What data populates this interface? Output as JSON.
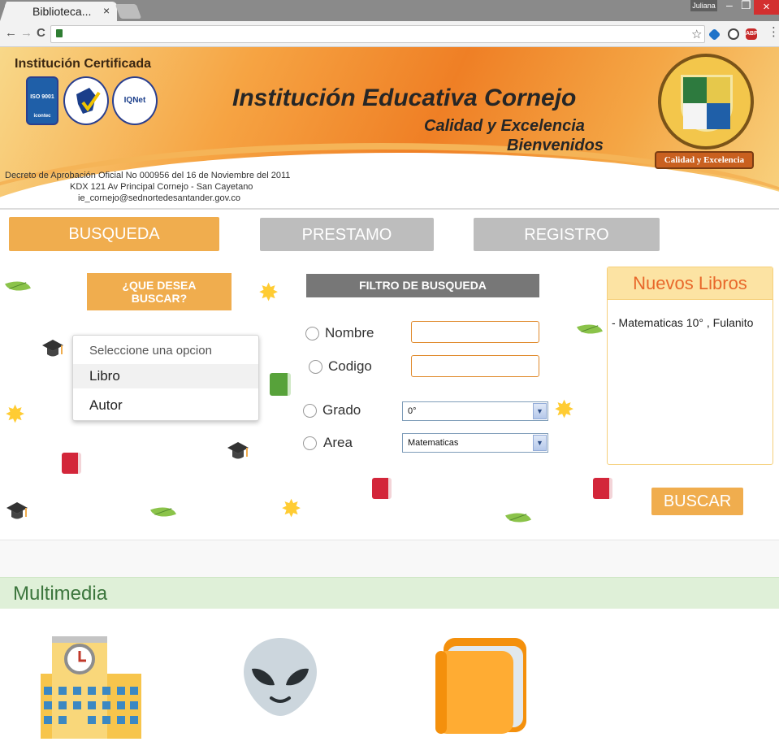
{
  "browser": {
    "tab_title": "Biblioteca...",
    "tab_close": "×",
    "user": "Juliana",
    "back": "←",
    "forward": "→",
    "reload": "C",
    "bookmark": "☆",
    "menu": "⋮",
    "ext_abp": "ABP"
  },
  "banner": {
    "certified": "Institución Certificada",
    "name": "Institución Educativa Cornejo",
    "tagline": "Calidad y Excelencia",
    "welcome": "Bienvenidos",
    "crest_motto": "Calidad y Excelencia",
    "logos": [
      "ISO 9001",
      "icontec",
      "IQNet"
    ],
    "decree_lines": [
      "Decreto de Aprobación Oficial  No 000956 del 16 de Noviembre del 2011",
      "KDX 121 Av Principal Cornejo - San Cayetano",
      "ie_cornejo@sednortedesantander.gov.co"
    ]
  },
  "nav": {
    "busqueda": "BUSQUEDA",
    "prestamo": "PRESTAMO",
    "registro": "REGISTRO"
  },
  "search": {
    "que_desea_line1": "¿QUE DESEA",
    "que_desea_line2": "BUSCAR?",
    "dropdown": {
      "placeholder": "Seleccione una opcion",
      "options": [
        "Libro",
        "Autor"
      ]
    },
    "filter_title": "FILTRO DE BUSQUEDA",
    "fields": {
      "nombre": "Nombre",
      "codigo": "Codigo",
      "grado": "Grado",
      "area": "Area"
    },
    "grado_value": "0°",
    "area_value": "Matematicas",
    "buscar": "BUSCAR"
  },
  "nuevos": {
    "title": "Nuevos Libros",
    "items": [
      "- Matematicas 10° , Fulanito"
    ]
  },
  "multimedia": {
    "title": "Multimedia"
  },
  "colors": {
    "accent_orange": "#f0ad4e",
    "inactive_gray": "#bdbdbd",
    "filter_gray": "#777777",
    "multimedia_green": "#3c763d"
  }
}
